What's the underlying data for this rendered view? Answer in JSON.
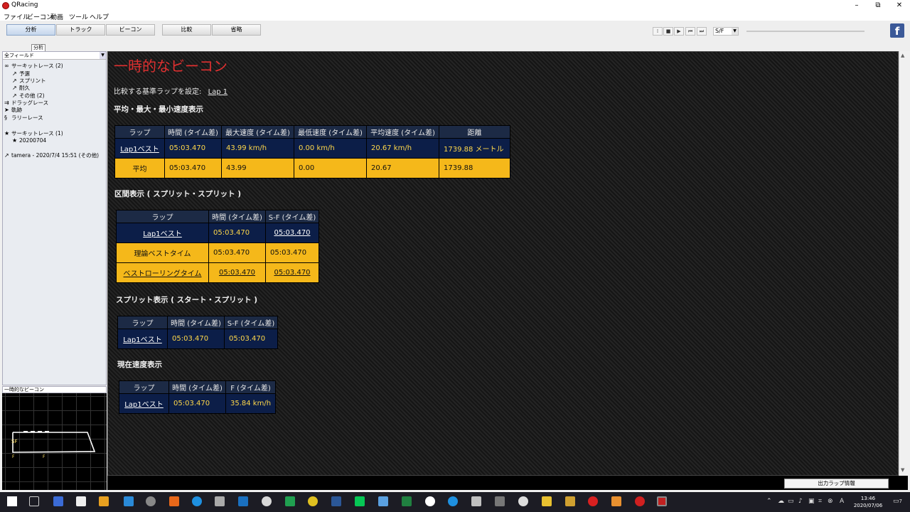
{
  "window": {
    "title": "QRacing",
    "minimize": "–",
    "maximize": "⧉",
    "close": "✕"
  },
  "menu": [
    "ファイル",
    "ビーコン",
    "動画",
    "ツール",
    "ヘルプ"
  ],
  "tabs": [
    "分析",
    "トラック",
    "ビーコン",
    "比較",
    "省略"
  ],
  "tooltip": "分析",
  "player": {
    "buttons": [
      "⁞",
      "■",
      "▶",
      "⏮",
      "⏭"
    ],
    "segment": "S/F"
  },
  "facebook": "f",
  "left": {
    "field_select": "全フィールド",
    "tree": [
      {
        "icon": "∞",
        "label": "サーキットレース (2)",
        "indent": 0
      },
      {
        "icon": "↗",
        "label": "予選",
        "indent": 1
      },
      {
        "icon": "↗",
        "label": "スプリント",
        "indent": 1
      },
      {
        "icon": "↗",
        "label": "耐久",
        "indent": 1
      },
      {
        "icon": "↗",
        "label": "その他 (2)",
        "indent": 1
      },
      {
        "icon": "⇉",
        "label": "ドラッグレース",
        "indent": 0
      },
      {
        "icon": "➤",
        "label": "軌跡",
        "indent": 0
      },
      {
        "icon": "§",
        "label": "ラリーレース",
        "indent": 0
      },
      {
        "icon": "★",
        "label": "サーキットレース (1)",
        "indent": 0
      },
      {
        "icon": "★",
        "label": "20200704",
        "indent": 1
      },
      {
        "icon": "↗",
        "label": "tamera - 2020/7/4 15:51 (その他)",
        "indent": 0
      }
    ],
    "mini_title": "一時的なビーコン",
    "map_labels": [
      "SF",
      "F",
      "F"
    ]
  },
  "main": {
    "title": "一時的なビーコン",
    "ref_label": "比較する基準ラップを設定:",
    "ref_lap": "Lap 1",
    "sec1": {
      "heading": "平均・最大・最小速度表示",
      "headers": [
        "ラップ",
        "時間 (タイム差)",
        "最大速度 (タイム差)",
        "最低速度 (タイム差)",
        "平均速度 (タイム差)",
        "距離"
      ],
      "rows": [
        [
          "Lap1ベスト",
          "05:03.470",
          "43.99 km/h",
          "0.00 km/h",
          "20.67 km/h",
          "1739.88 メートル"
        ],
        [
          "平均",
          "05:03.470",
          "43.99",
          "0.00",
          "20.67",
          "1739.88"
        ]
      ]
    },
    "sec2": {
      "heading": "区間表示 ( スプリット・スプリット )",
      "headers": [
        "ラップ",
        "時間 (タイム差)",
        "S-F (タイム差)"
      ],
      "rows": [
        [
          "Lap1ベスト",
          "05:03.470",
          "05:03.470"
        ],
        [
          "理論ベストタイム",
          "05:03.470",
          "05:03.470"
        ],
        [
          "ベストローリングタイム",
          "05:03.470",
          "05:03.470"
        ]
      ]
    },
    "sec3": {
      "heading": "スプリット表示 ( スタート・スプリット )",
      "headers": [
        "ラップ",
        "時間 (タイム差)",
        "S-F (タイム差)"
      ],
      "rows": [
        [
          "Lap1ベスト",
          "05:03.470",
          "05:03.470"
        ]
      ]
    },
    "sec4": {
      "heading": "現在速度表示",
      "headers": [
        "ラップ",
        "時間 (タイム差)",
        "F (タイム差)"
      ],
      "rows": [
        [
          "Lap1ベスト",
          "05:03.470",
          "35.84 km/h"
        ]
      ]
    }
  },
  "status": {
    "output_button": "出力ラップ情報"
  },
  "taskbar": {
    "time": "13:46",
    "date": "2020/07/06",
    "notif": "7"
  }
}
